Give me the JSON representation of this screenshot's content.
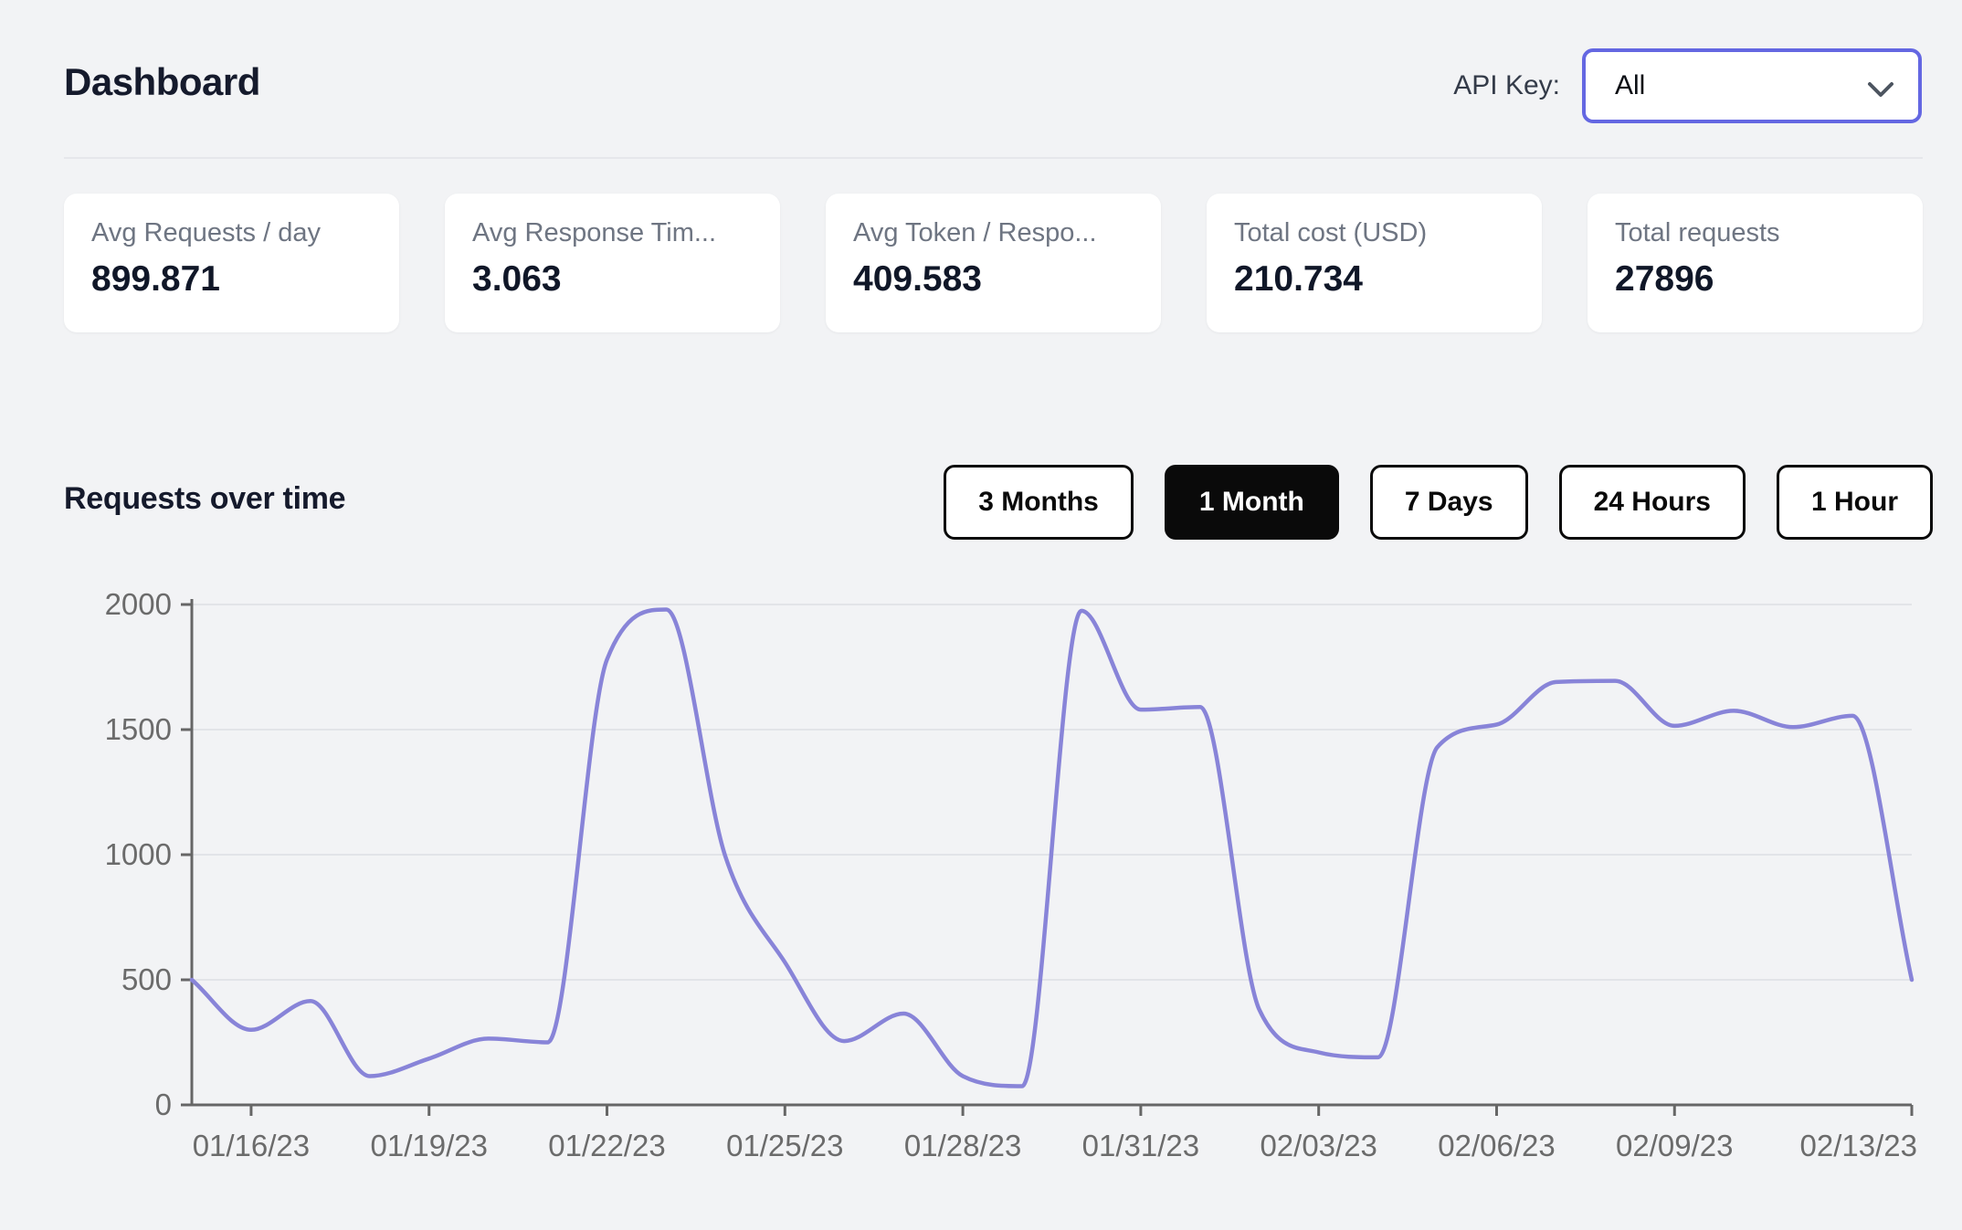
{
  "header": {
    "title": "Dashboard",
    "api_key": {
      "label": "API Key:",
      "selected": "All"
    }
  },
  "stats": [
    {
      "label": "Avg Requests / day",
      "value": "899.871"
    },
    {
      "label": "Avg Response Tim...",
      "value": "3.063"
    },
    {
      "label": "Avg Token / Respo...",
      "value": "409.583"
    },
    {
      "label": "Total cost (USD)",
      "value": "210.734"
    },
    {
      "label": "Total requests",
      "value": "27896"
    }
  ],
  "section": {
    "title": "Requests over time"
  },
  "range_buttons": [
    {
      "label": "3 Months",
      "active": false
    },
    {
      "label": "1 Month",
      "active": true
    },
    {
      "label": "7 Days",
      "active": false
    },
    {
      "label": "24 Hours",
      "active": false
    },
    {
      "label": "1 Hour",
      "active": false
    }
  ],
  "colors": {
    "accent": "#6467e2",
    "line": "#8884d8",
    "button_active_bg": "#0a0a0a",
    "page_bg": "#f2f3f5",
    "axis": "#666666",
    "grid": "#e2e4e8",
    "tick_text": "#6b6b6b"
  },
  "chart_data": {
    "type": "line",
    "title": "Requests over time",
    "xlabel": "",
    "ylabel": "",
    "ylim": [
      0,
      2000
    ],
    "y_ticks": [
      0,
      500,
      1000,
      1500,
      2000
    ],
    "grid": "horizontal",
    "legend": "none",
    "x": [
      "01/15/23",
      "01/16/23",
      "01/17/23",
      "01/18/23",
      "01/19/23",
      "01/20/23",
      "01/21/23",
      "01/22/23",
      "01/23/23",
      "01/24/23",
      "01/25/23",
      "01/26/23",
      "01/27/23",
      "01/28/23",
      "01/29/23",
      "01/30/23",
      "01/31/23",
      "02/01/23",
      "02/02/23",
      "02/03/23",
      "02/04/23",
      "02/05/23",
      "02/06/23",
      "02/07/23",
      "02/08/23",
      "02/09/23",
      "02/10/23",
      "02/11/23",
      "02/12/23",
      "02/13/23"
    ],
    "values": [
      500,
      300,
      415,
      115,
      185,
      265,
      250,
      1780,
      1980,
      990,
      570,
      255,
      365,
      115,
      75,
      1975,
      1580,
      1590,
      380,
      210,
      190,
      1430,
      1520,
      1690,
      1695,
      1515,
      1575,
      1510,
      1555,
      500
    ],
    "x_ticks": [
      {
        "label": "01/16/23",
        "index": 1
      },
      {
        "label": "01/19/23",
        "index": 4
      },
      {
        "label": "01/22/23",
        "index": 7
      },
      {
        "label": "01/25/23",
        "index": 10
      },
      {
        "label": "01/28/23",
        "index": 13
      },
      {
        "label": "01/31/23",
        "index": 16
      },
      {
        "label": "02/03/23",
        "index": 19
      },
      {
        "label": "02/06/23",
        "index": 22
      },
      {
        "label": "02/09/23",
        "index": 25
      },
      {
        "label": "02/13/23",
        "index": 29,
        "align": "end"
      }
    ]
  }
}
